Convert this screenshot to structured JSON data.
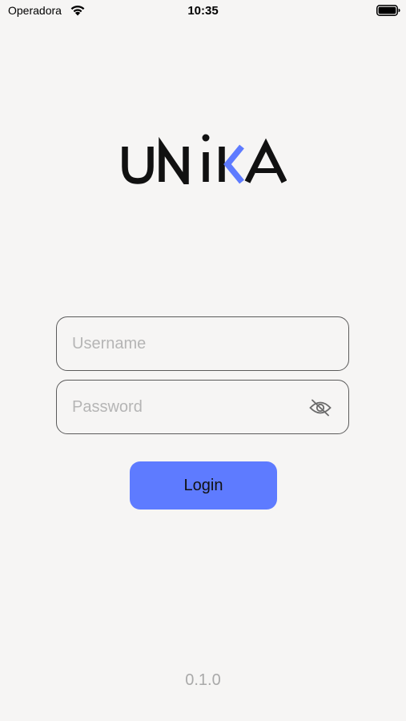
{
  "status_bar": {
    "carrier": "Operadora",
    "time": "10:35",
    "wifi_icon": "wifi-icon",
    "battery_icon": "battery-icon"
  },
  "logo": {
    "text": "UNIKA",
    "icon": "unika-logo",
    "accent_color": "#5e7bff",
    "text_color": "#111111"
  },
  "form": {
    "username_placeholder": "Username",
    "password_placeholder": "Password",
    "username_value": "",
    "password_value": "",
    "visibility_icon": "eye-off-icon",
    "login_label": "Login",
    "login_color": "#5e7bff"
  },
  "footer": {
    "version": "0.1.0"
  }
}
